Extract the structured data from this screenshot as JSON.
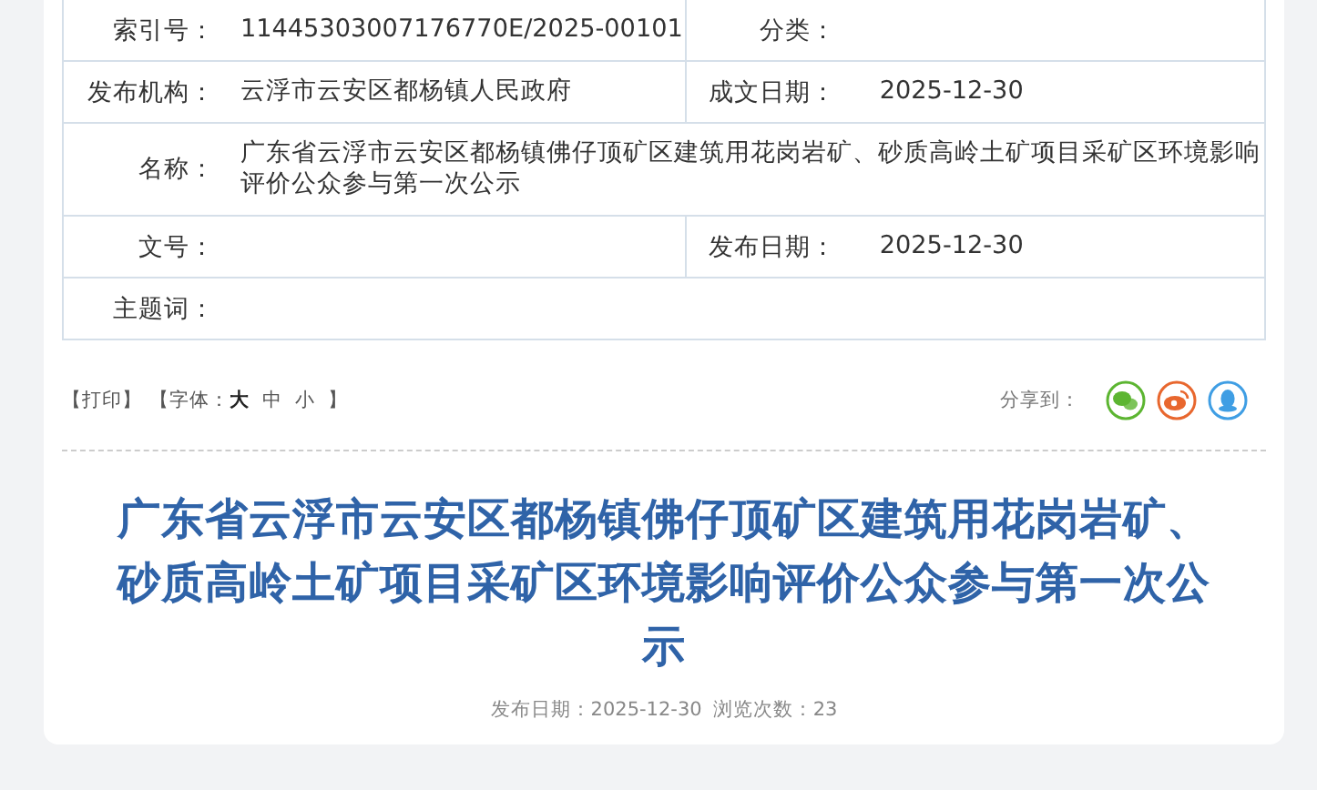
{
  "meta_table": {
    "rows": [
      {
        "cells": [
          {
            "label": "索引号：",
            "value": "11445303007176770E/2025-00101"
          },
          {
            "label": "分类："
          }
        ]
      },
      {
        "cells": [
          {
            "label": "发布机构：",
            "value": "云浮市云安区都杨镇人民政府"
          },
          {
            "label": "成文日期：",
            "value": "2025-12-30"
          }
        ]
      },
      {
        "cells": [
          {
            "label": "名称：",
            "value": "广东省云浮市云安区都杨镇佛仔顶矿区建筑用花岗岩矿、砂质高岭土矿项目采矿区环境影响评价公众参与第一次公示"
          }
        ]
      },
      {
        "cells": [
          {
            "label": "文号："
          },
          {
            "label": "发布日期：",
            "value": "2025-12-30"
          }
        ]
      },
      {
        "cells": [
          {
            "label": "主题词："
          }
        ]
      }
    ]
  },
  "toolbar": {
    "print": "【打印】",
    "font_label": "【字体：",
    "font_sizes": [
      {
        "label": "大",
        "selected": true
      },
      {
        "label": "中",
        "selected": false
      },
      {
        "label": "小",
        "selected": false
      }
    ],
    "font_close": "】",
    "share_label": "分享到：",
    "share": [
      {
        "kind": "wechat",
        "color": "#5cb531"
      },
      {
        "kind": "weibo",
        "color": "#e8672e"
      },
      {
        "kind": "qq",
        "color": "#3f9ee4"
      }
    ]
  },
  "article": {
    "title": "广东省云浮市云安区都杨镇佛仔顶矿区建筑用花岗岩矿、砂质高岭土矿项目采矿区环境影响评价公众参与第一次公示",
    "date_label": "发布日期：",
    "date": "2025-12-30",
    "views_label": "浏览次数：",
    "views": "23"
  }
}
